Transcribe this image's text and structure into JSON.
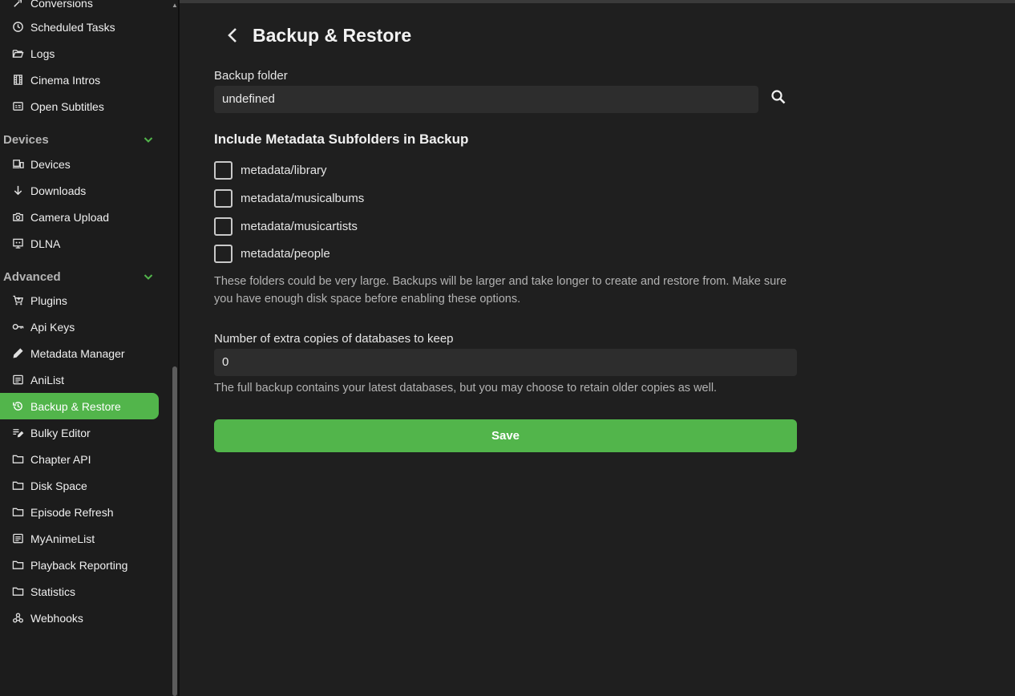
{
  "sidebar": {
    "top_partial_label": "Conversions",
    "items_top": [
      {
        "label": "Scheduled Tasks",
        "icon": "clock-icon"
      },
      {
        "label": "Logs",
        "icon": "folder-open-icon"
      },
      {
        "label": "Cinema Intros",
        "icon": "film-icon"
      },
      {
        "label": "Open Subtitles",
        "icon": "subtitles-icon"
      }
    ],
    "devices_section": {
      "label": "Devices",
      "items": [
        {
          "label": "Devices",
          "icon": "devices-icon"
        },
        {
          "label": "Downloads",
          "icon": "arrow-down-icon"
        },
        {
          "label": "Camera Upload",
          "icon": "camera-icon"
        },
        {
          "label": "DLNA",
          "icon": "dlna-icon"
        }
      ]
    },
    "advanced_section": {
      "label": "Advanced",
      "items": [
        {
          "label": "Plugins",
          "icon": "cart-icon"
        },
        {
          "label": "Api Keys",
          "icon": "key-icon"
        },
        {
          "label": "Metadata Manager",
          "icon": "pencil-icon"
        },
        {
          "label": "AniList",
          "icon": "list-icon"
        },
        {
          "label": "Backup & Restore",
          "icon": "restore-icon",
          "active": true
        },
        {
          "label": "Bulky Editor",
          "icon": "edit-note-icon"
        },
        {
          "label": "Chapter API",
          "icon": "folder-icon"
        },
        {
          "label": "Disk Space",
          "icon": "folder-icon"
        },
        {
          "label": "Episode Refresh",
          "icon": "folder-icon"
        },
        {
          "label": "MyAnimeList",
          "icon": "list-icon"
        },
        {
          "label": "Playback Reporting",
          "icon": "folder-icon"
        },
        {
          "label": "Statistics",
          "icon": "folder-icon"
        },
        {
          "label": "Webhooks",
          "icon": "webhook-icon"
        }
      ]
    }
  },
  "page": {
    "title": "Backup & Restore",
    "backup_folder_label": "Backup folder",
    "backup_folder_value": "undefined",
    "include_title": "Include Metadata Subfolders in Backup",
    "checkboxes": [
      {
        "label": "metadata/library",
        "checked": false
      },
      {
        "label": "metadata/musicalbums",
        "checked": false
      },
      {
        "label": "metadata/musicartists",
        "checked": false
      },
      {
        "label": "metadata/people",
        "checked": false
      }
    ],
    "folders_help": "These folders could be very large. Backups will be larger and take longer to create and restore from. Make sure you have enough disk space before enabling these options.",
    "copies_label": "Number of extra copies of databases to keep",
    "copies_value": "0",
    "copies_help": "The full backup contains your latest databases, but you may choose to retain older copies as well.",
    "save_label": "Save"
  },
  "colors": {
    "accent": "#52b54b",
    "background": "#1f1f1f",
    "input": "#2d2d2d"
  }
}
